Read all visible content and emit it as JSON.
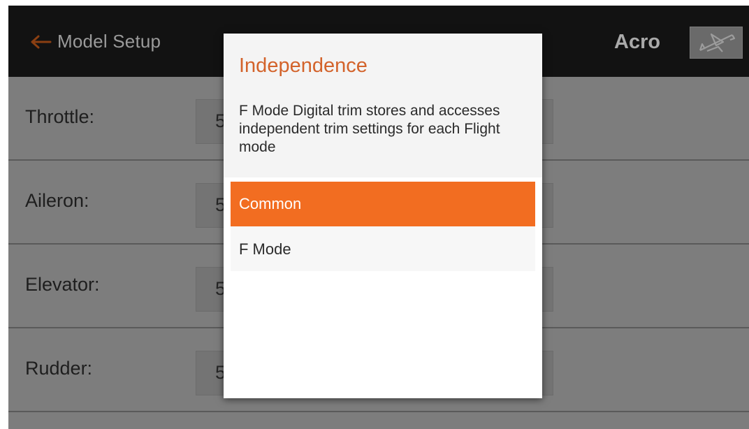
{
  "header": {
    "back_label": "Model Setup",
    "mode_label": "Acro",
    "plane_icon": "airplane-icon"
  },
  "rows": [
    {
      "label": "Throttle:",
      "value_char": "5"
    },
    {
      "label": "Aileron:",
      "value_char": "5"
    },
    {
      "label": "Elevator:",
      "value_char": "5"
    },
    {
      "label": "Rudder:",
      "value_char": "5"
    }
  ],
  "dialog": {
    "title": "Independence",
    "description": "F Mode Digital trim stores and accesses independent trim settings for each Flight mode",
    "options": [
      {
        "label": "Common",
        "selected": true
      },
      {
        "label": "F Mode",
        "selected": false
      }
    ]
  },
  "colors": {
    "accent": "#f26d21",
    "title": "#d3632b",
    "topbar": "#121212",
    "dimmed_background": "#7d7d7d"
  }
}
